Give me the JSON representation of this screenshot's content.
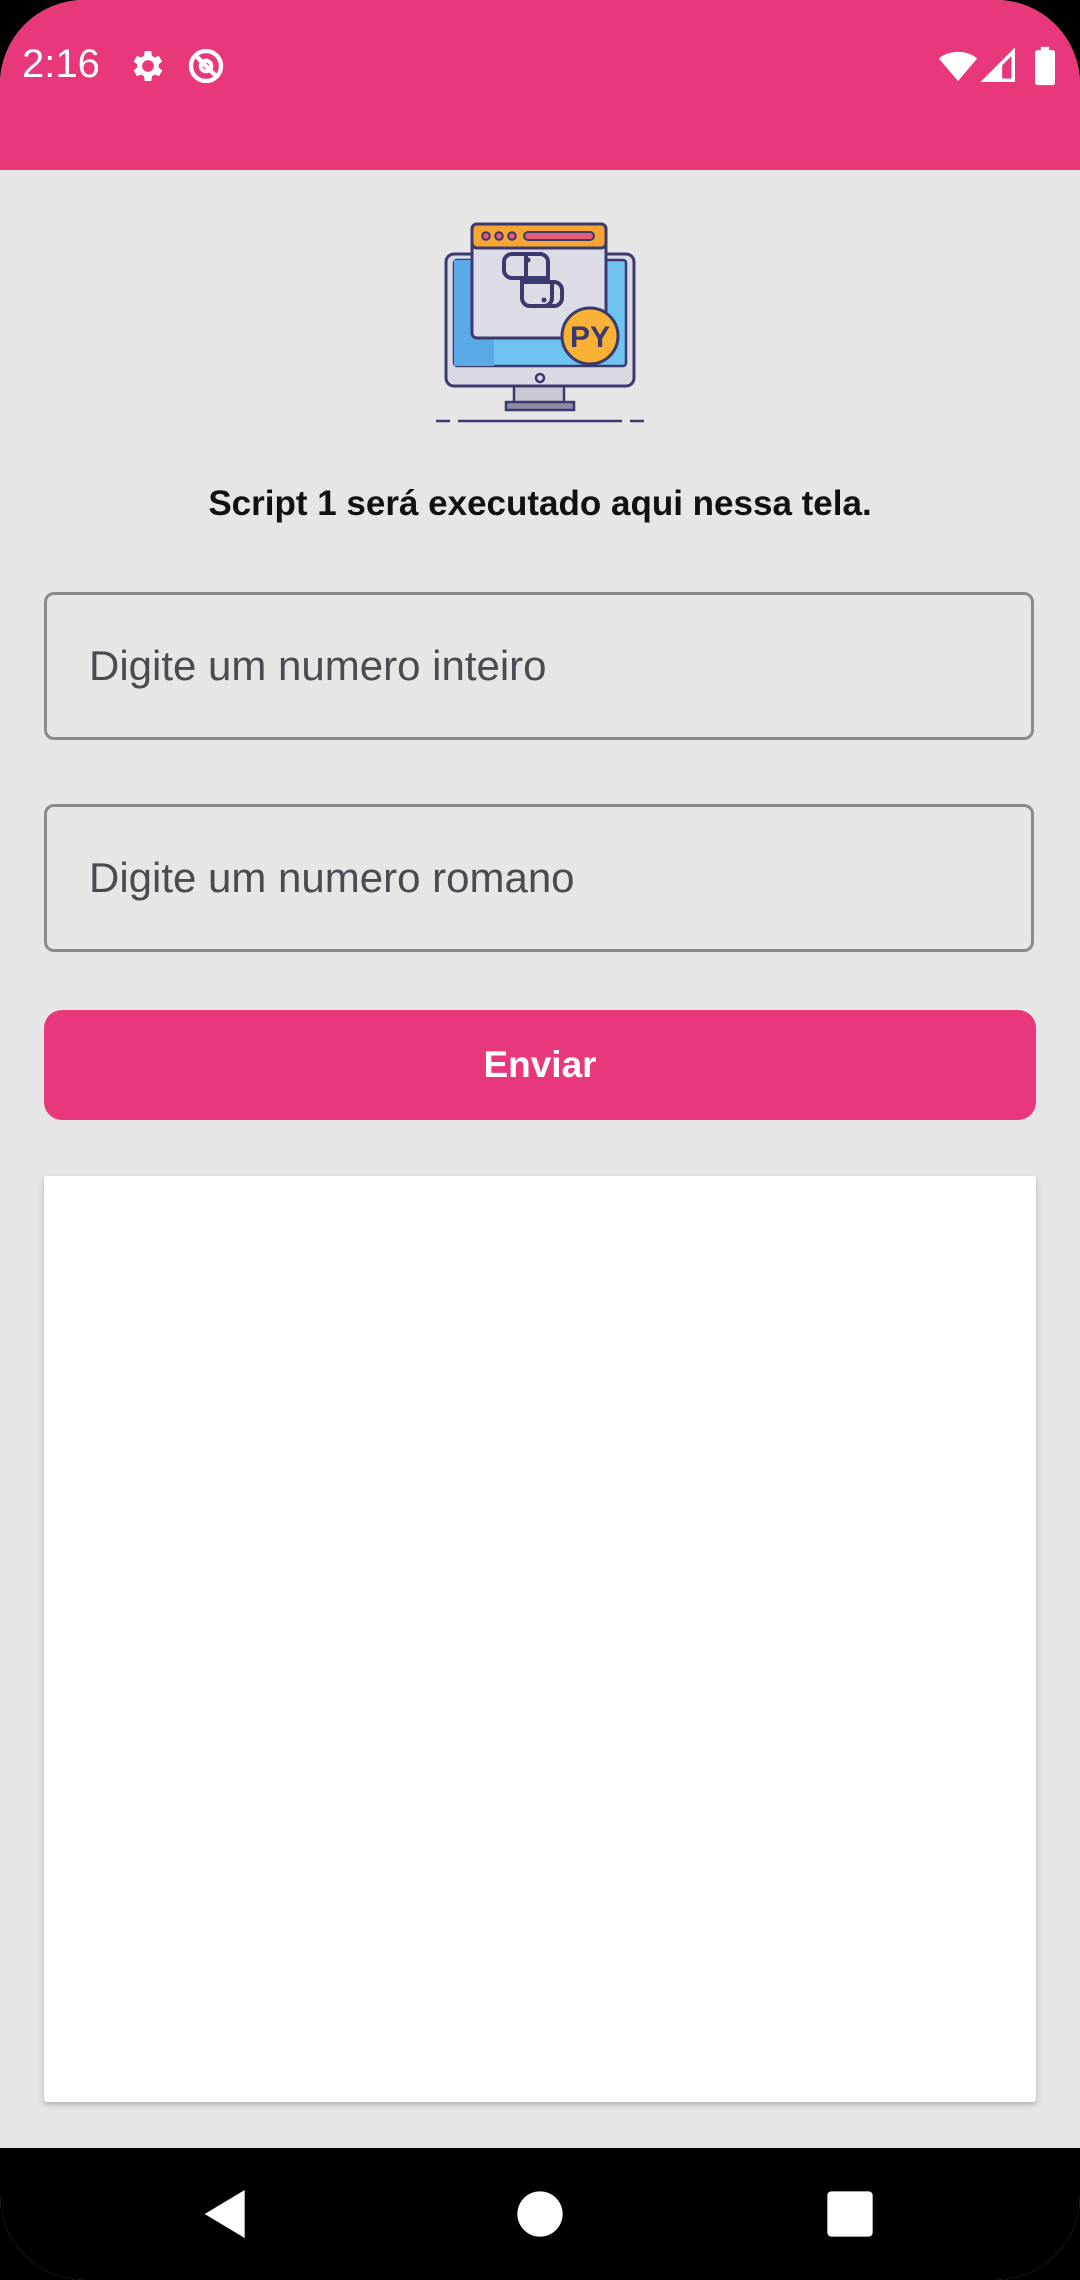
{
  "status_bar": {
    "time": "2:16",
    "icons": [
      "gear-icon",
      "sync-off-icon",
      "wifi-icon",
      "signal-icon",
      "battery-icon"
    ],
    "background_color": "#e8377b"
  },
  "logo": {
    "icon": "python-monitor-icon",
    "badge_text": "PY"
  },
  "instruction": "Script 1 será executado aqui nessa tela.",
  "fields": {
    "integer_placeholder": "Digite um numero inteiro",
    "integer_value": "",
    "roman_placeholder": "Digite um numero romano",
    "roman_value": ""
  },
  "send_button": {
    "label": "Enviar",
    "color": "#e8377b"
  },
  "output_panel": {
    "text": ""
  },
  "nav_bar": {
    "icons": [
      "back-icon",
      "home-icon",
      "recents-icon"
    ]
  }
}
